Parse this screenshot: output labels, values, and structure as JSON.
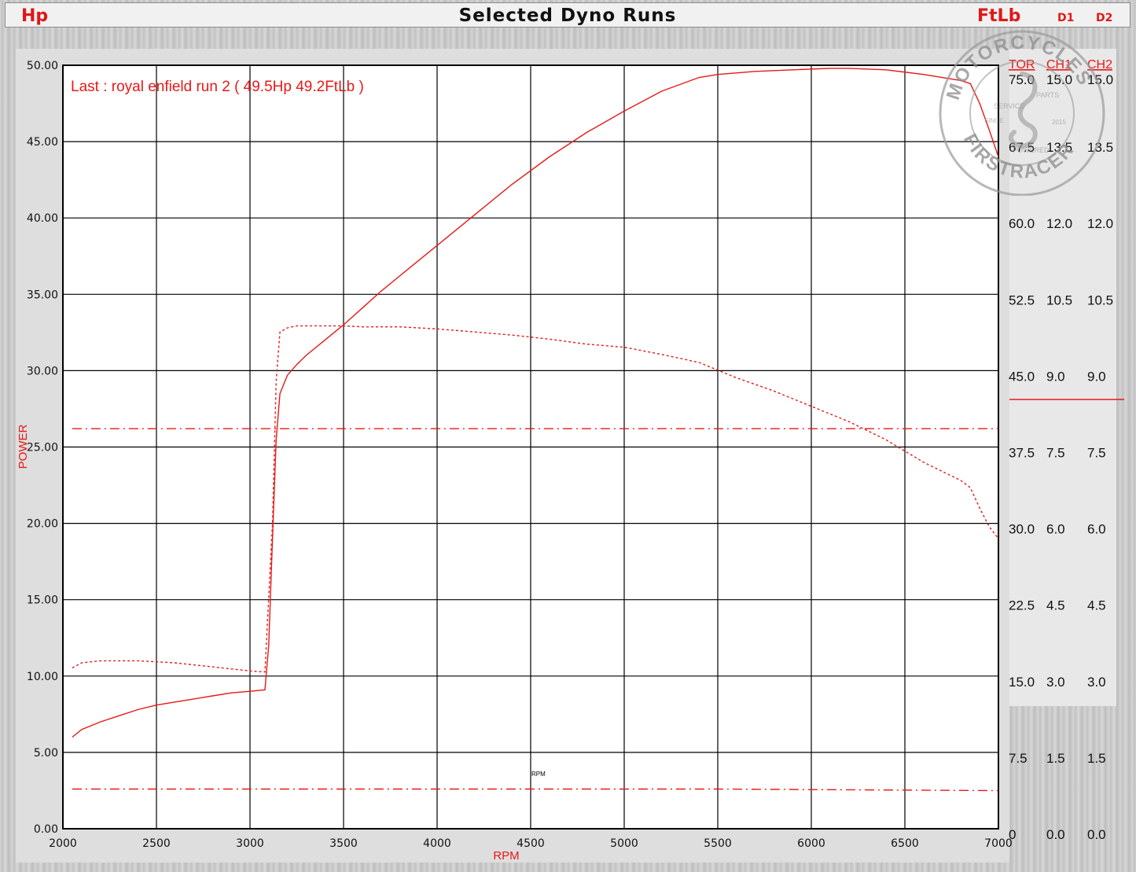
{
  "header": {
    "left_unit": "Hp",
    "title": "Selected Dyno Runs",
    "right_unit": "FtLb",
    "d1": "D1",
    "d2": "D2"
  },
  "annotation": "Last : royal enfield run 2 ( 49.5Hp  49.2FtLb )",
  "center_marker": "RPM",
  "stamp": {
    "arc_top": "MOTORCYCLES",
    "arc_bottom": "FIRSTRACER",
    "words": [
      "SERVICE",
      "PARTS",
      "POWERED",
      "SINCE",
      "2015"
    ]
  },
  "colors": {
    "series": "#e81818",
    "grid": "#000000",
    "plot_bg": "#ffffff",
    "frame": "#dedede"
  },
  "chart_data": {
    "type": "line",
    "xlabel": "RPM",
    "ylabel": "POWER",
    "xlim": [
      2000,
      7000
    ],
    "ylim": [
      0,
      50
    ],
    "x_ticks": [
      "2000",
      "2500",
      "3000",
      "3500",
      "4000",
      "4500",
      "5000",
      "5500",
      "6000",
      "6500",
      "7000"
    ],
    "y_ticks": [
      "0.00",
      "5.00",
      "10.00",
      "15.00",
      "20.00",
      "25.00",
      "30.00",
      "35.00",
      "40.00",
      "45.00",
      "50.00"
    ],
    "right_axes": {
      "headers": [
        "TOR",
        "CH1",
        "CH2"
      ],
      "rows": [
        [
          "75.0",
          "15.0",
          "15.0"
        ],
        [
          "67.5",
          "13.5",
          "13.5"
        ],
        [
          "60.0",
          "12.0",
          "12.0"
        ],
        [
          "52.5",
          "10.5",
          "10.5"
        ],
        [
          "45.0",
          "9.0",
          "9.0"
        ],
        [
          "37.5",
          "7.5",
          "7.5"
        ],
        [
          "30.0",
          "6.0",
          "6.0"
        ],
        [
          "22.5",
          "4.5",
          "4.5"
        ],
        [
          "15.0",
          "3.0",
          "3.0"
        ],
        [
          "7.5",
          "1.5",
          "1.5"
        ],
        [
          "0",
          "0.0",
          "0.0"
        ]
      ],
      "torque_range": [
        0,
        75
      ]
    },
    "series": [
      {
        "label": "Hp",
        "axis": "power",
        "style": "solid",
        "x": [
          2050,
          2100,
          2200,
          2300,
          2400,
          2500,
          2600,
          2700,
          2800,
          2900,
          3000,
          3080,
          3100,
          3120,
          3140,
          3160,
          3200,
          3250,
          3300,
          3400,
          3500,
          3600,
          3700,
          3800,
          3900,
          4000,
          4200,
          4400,
          4600,
          4800,
          5000,
          5200,
          5400,
          5500,
          5700,
          5900,
          6100,
          6200,
          6400,
          6600,
          6800,
          6850,
          6900,
          6950,
          7000
        ],
        "y": [
          6.0,
          6.5,
          7.0,
          7.4,
          7.8,
          8.1,
          8.3,
          8.5,
          8.7,
          8.9,
          9.0,
          9.1,
          12.0,
          19.0,
          25.5,
          28.5,
          29.7,
          30.4,
          31.0,
          32.0,
          33.0,
          34.1,
          35.2,
          36.2,
          37.2,
          38.2,
          40.2,
          42.2,
          44.0,
          45.6,
          47.0,
          48.3,
          49.2,
          49.4,
          49.6,
          49.7,
          49.8,
          49.8,
          49.7,
          49.4,
          49.0,
          48.8,
          47.5,
          45.8,
          44.0
        ]
      },
      {
        "label": "FtLb",
        "axis": "torque",
        "style": "dotted",
        "x": [
          2050,
          2100,
          2200,
          2300,
          2400,
          2500,
          2600,
          2700,
          2800,
          2900,
          3000,
          3080,
          3120,
          3140,
          3160,
          3200,
          3250,
          3300,
          3400,
          3500,
          3600,
          3700,
          3800,
          3900,
          4000,
          4200,
          4400,
          4600,
          4800,
          5000,
          5200,
          5400,
          5600,
          5800,
          6000,
          6200,
          6400,
          6600,
          6800,
          6850,
          6900,
          6950,
          7000
        ],
        "y": [
          15.8,
          16.3,
          16.5,
          16.5,
          16.5,
          16.4,
          16.3,
          16.1,
          15.9,
          15.7,
          15.5,
          15.4,
          30.0,
          44.0,
          48.8,
          49.2,
          49.4,
          49.4,
          49.4,
          49.4,
          49.3,
          49.3,
          49.3,
          49.2,
          49.1,
          48.8,
          48.5,
          48.1,
          47.6,
          47.3,
          46.6,
          45.8,
          44.3,
          43.0,
          41.5,
          40.0,
          38.2,
          36.0,
          34.2,
          33.5,
          31.5,
          29.7,
          28.5
        ]
      },
      {
        "label": "CH1",
        "axis": "power",
        "style": "dash-dot",
        "x": [
          2050,
          7000
        ],
        "y": [
          26.2,
          26.2
        ]
      },
      {
        "label": "CH2",
        "axis": "power",
        "style": "dash-dot",
        "x": [
          2050,
          5500,
          7000
        ],
        "y": [
          2.6,
          2.6,
          2.5
        ]
      }
    ]
  }
}
